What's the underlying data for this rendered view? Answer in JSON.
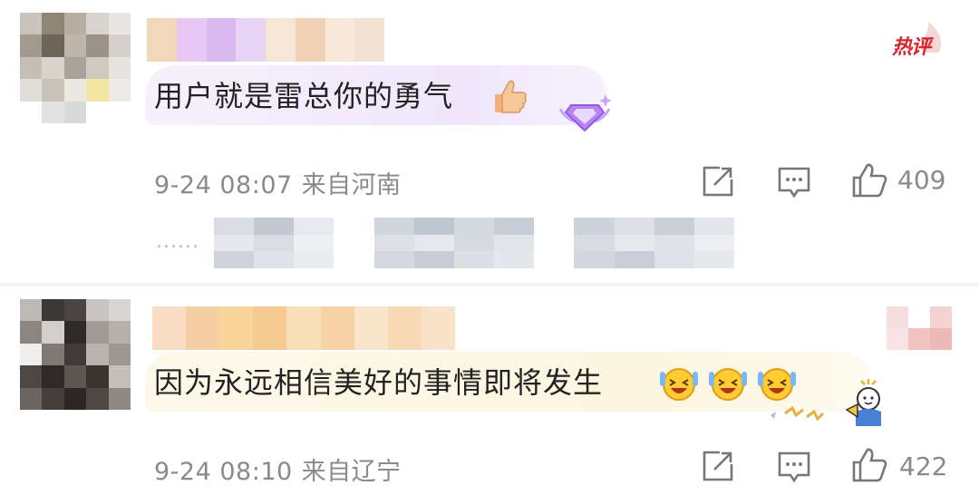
{
  "comments": [
    {
      "text": "用户就是雷总你的勇气",
      "timestamp": "9-24 08:07",
      "location": "来自河南",
      "likes": "409",
      "badge": "热评"
    },
    {
      "text": "因为永远相信美好的事情即将发生",
      "timestamp": "9-24 08:10",
      "location": "来自辽宁",
      "likes": "422"
    }
  ],
  "replies": {
    "ellipsis": "......"
  },
  "colors": {
    "hot_red": "#d9262c",
    "meta_gray": "#8a8a8a",
    "bubble_purple": "#f1ebfa",
    "bubble_yellow": "#fdf8e6"
  },
  "icons": [
    "share-icon",
    "comment-icon",
    "thumbs-up-icon",
    "thumbs-up-emoji-icon",
    "crown-gem-icon",
    "laughing-emoji-icon",
    "cheering-character-icon"
  ]
}
